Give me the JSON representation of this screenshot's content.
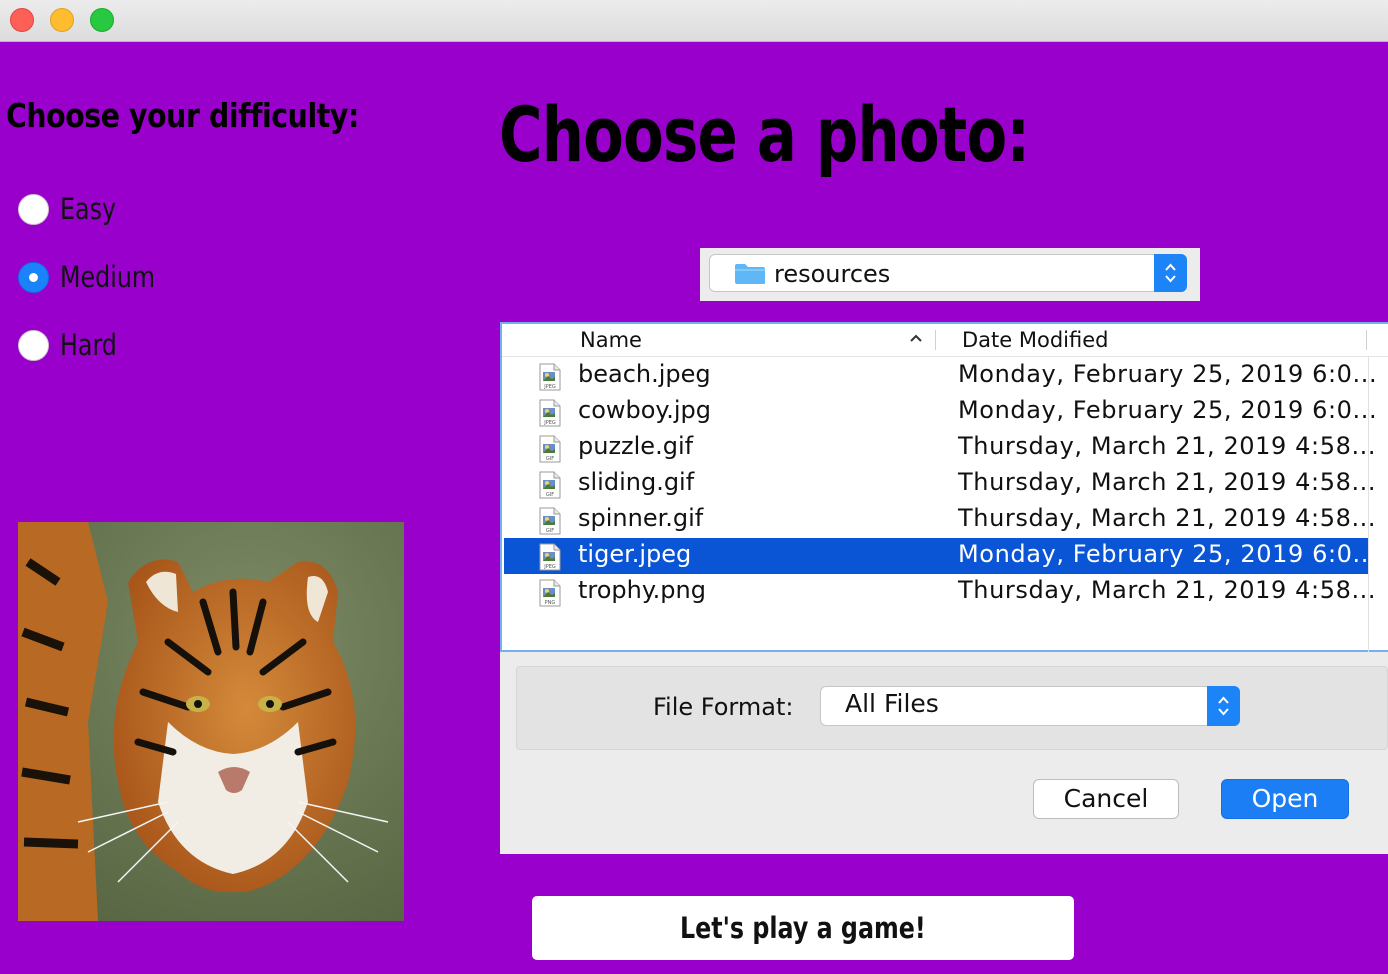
{
  "window": {
    "title": ""
  },
  "difficulty": {
    "title": "Choose your difficulty:",
    "options": [
      {
        "label": "Easy",
        "selected": false
      },
      {
        "label": "Medium",
        "selected": true
      },
      {
        "label": "Hard",
        "selected": false
      }
    ]
  },
  "preview": {
    "image": "tiger-photo"
  },
  "photo": {
    "title": "Choose a photo:"
  },
  "file_dialog": {
    "location": "resources",
    "columns": {
      "name": "Name",
      "date": "Date Modified"
    },
    "files": [
      {
        "name": "beach.jpeg",
        "date": "Monday, February 25, 2019 6:0...",
        "type": "JPEG",
        "selected": false
      },
      {
        "name": "cowboy.jpg",
        "date": "Monday, February 25, 2019 6:0...",
        "type": "JPEG",
        "selected": false
      },
      {
        "name": "puzzle.gif",
        "date": "Thursday, March 21, 2019 4:58...",
        "type": "GIF",
        "selected": false
      },
      {
        "name": "sliding.gif",
        "date": "Thursday, March 21, 2019 4:58...",
        "type": "GIF",
        "selected": false
      },
      {
        "name": "spinner.gif",
        "date": "Thursday, March 21, 2019 4:58...",
        "type": "GIF",
        "selected": false
      },
      {
        "name": "tiger.jpeg",
        "date": "Monday, February 25, 2019 6:0...",
        "type": "JPEG",
        "selected": true
      },
      {
        "name": "trophy.png",
        "date": "Thursday, March 21, 2019 4:58...",
        "type": "PNG",
        "selected": false
      }
    ],
    "format_label": "File Format:",
    "format_value": "All Files",
    "cancel_label": "Cancel",
    "open_label": "Open"
  },
  "play_button": {
    "label": "Let's play a game!"
  },
  "colors": {
    "background": "#9a00cc",
    "selection": "#0a55d6",
    "accent": "#1c7ef4"
  }
}
